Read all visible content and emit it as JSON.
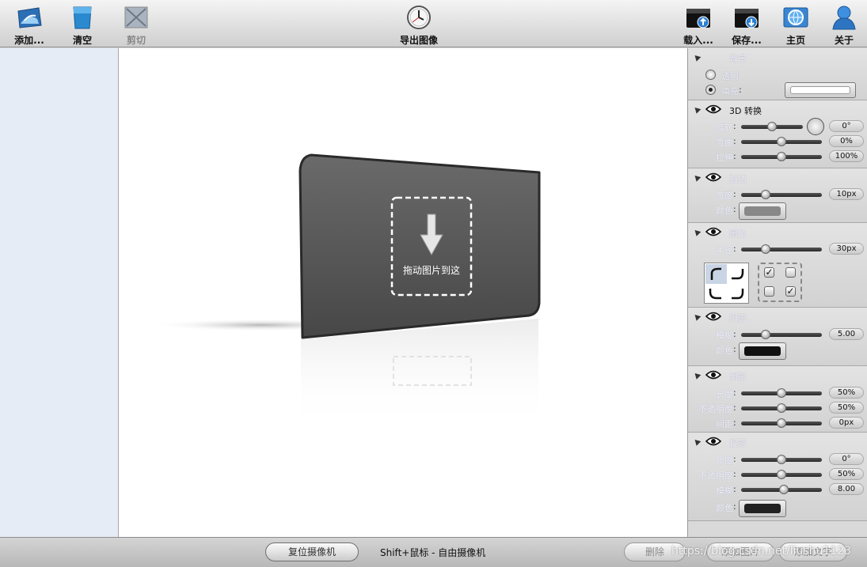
{
  "toolbar": {
    "add": "添加...",
    "clear": "清空",
    "cut": "剪切",
    "export": "导出图像",
    "load": "载入...",
    "save": "保存...",
    "home": "主页",
    "about": "关于"
  },
  "canvas": {
    "drop_text": "拖动图片到这"
  },
  "panel": {
    "background": {
      "title": "背景",
      "transparent": "透明",
      "fill": "填充",
      "fill_color": "#ffffff",
      "selected": "fill"
    },
    "transform3d": {
      "title": "3D 转换",
      "rows": [
        {
          "label": "旋转",
          "value": "0°",
          "fraction": 0.5
        },
        {
          "label": "弯曲",
          "value": "0%",
          "fraction": 0.5
        },
        {
          "label": "拉伸",
          "value": "100%",
          "fraction": 0.5
        }
      ]
    },
    "border": {
      "title": "描边",
      "width_label": "宽度",
      "width_value": "10px",
      "width_fraction": 0.3,
      "color_label": "颜色",
      "color": "#888888"
    },
    "corners": {
      "title": "圆角",
      "radius_label": "半径",
      "radius_value": "30px",
      "radius_fraction": 0.3
    },
    "shadow": {
      "title": "阴影",
      "blur_label": "模糊",
      "blur_value": "5.00",
      "blur_fraction": 0.3,
      "color_label": "颜色",
      "color": "#111111"
    },
    "reflection": {
      "title": "倒影",
      "rows": [
        {
          "label": "长度",
          "value": "50%",
          "fraction": 0.5
        },
        {
          "label": "不透明度",
          "value": "50%",
          "fraction": 0.5
        },
        {
          "label": "间距",
          "value": "0px",
          "fraction": 0.5
        }
      ]
    },
    "projection": {
      "title": "投影",
      "rows": [
        {
          "label": "角度",
          "value": "0°",
          "fraction": 0.5
        },
        {
          "label": "不透明度",
          "value": "50%",
          "fraction": 0.5
        },
        {
          "label": "模糊",
          "value": "8.00",
          "fraction": 0.53
        }
      ],
      "color_label": "颜色",
      "color": "#222222"
    }
  },
  "bottom": {
    "reset_camera": "复位摄像机",
    "hint": "Shift+鼠标 - 自由摄像机",
    "delete": "删除",
    "btn2": "添加图片",
    "btn3": "添加文字",
    "watermark": "https://blog.csdn.net/liushu1123"
  }
}
